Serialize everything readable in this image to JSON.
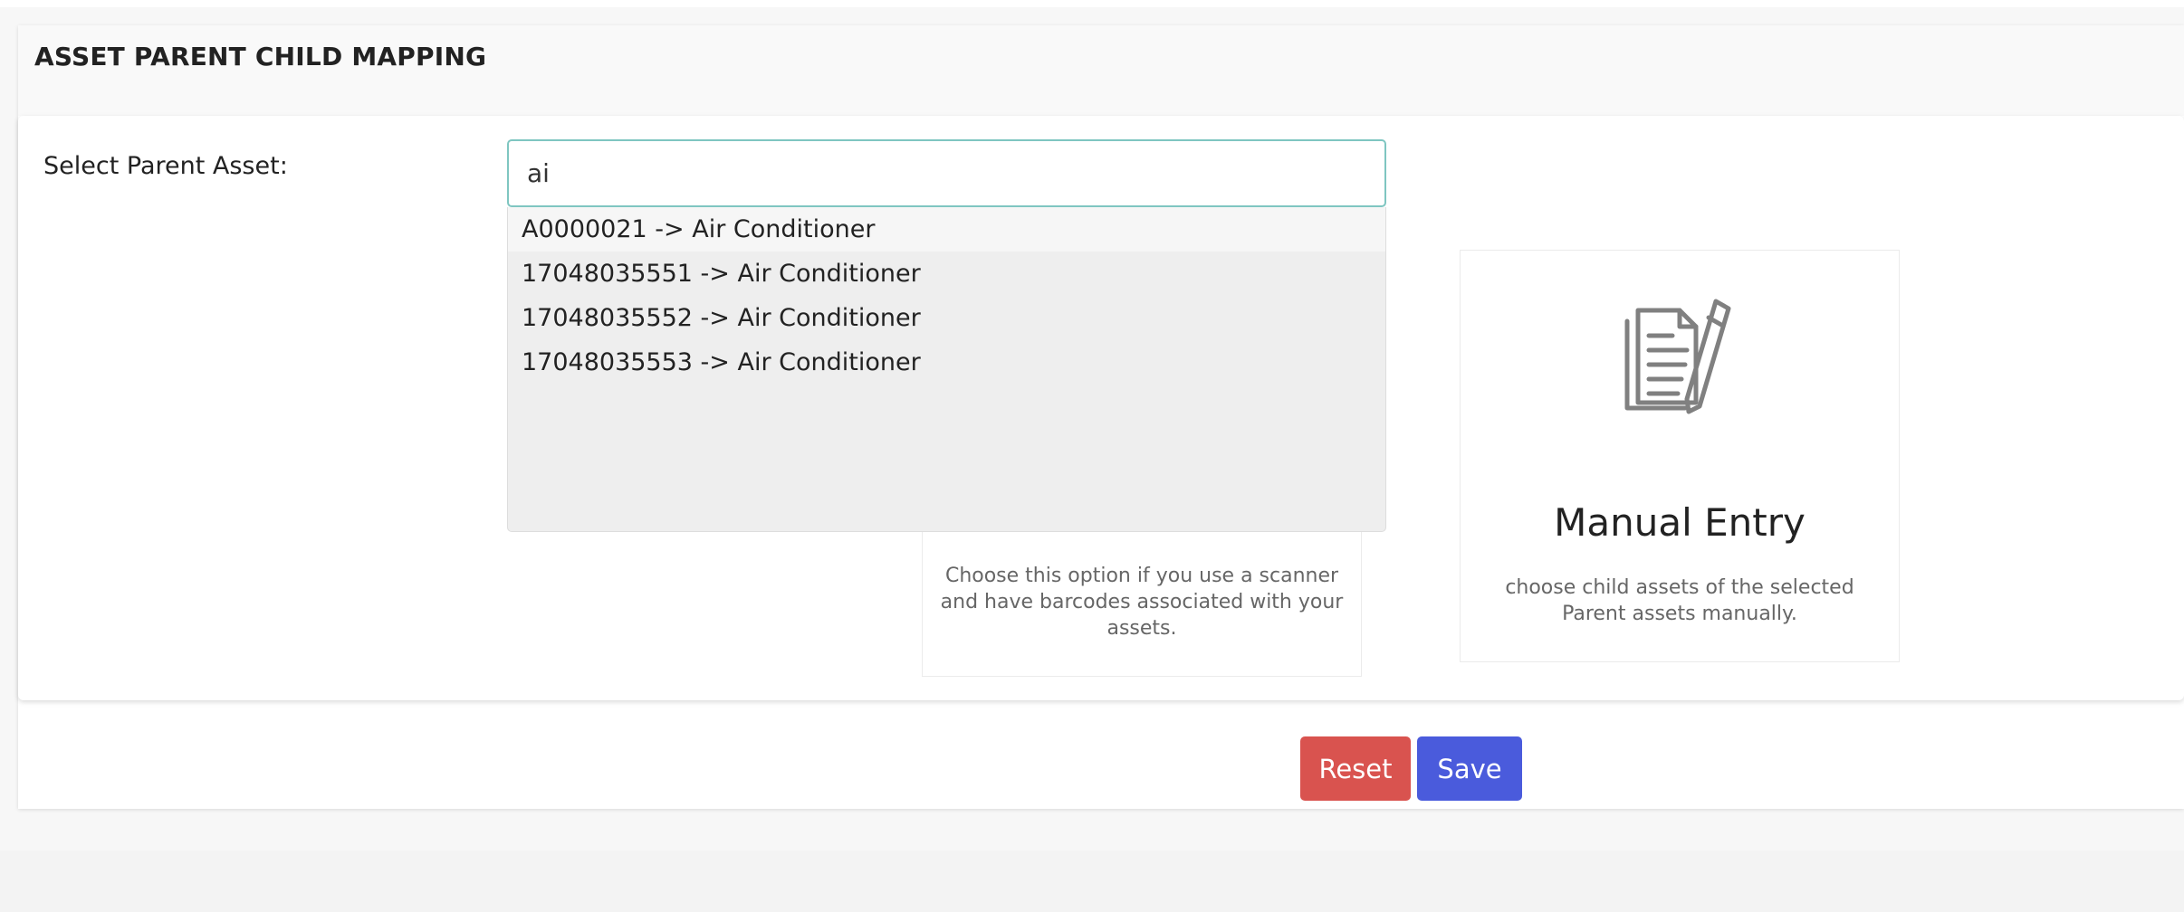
{
  "page": {
    "title": "ASSET PARENT CHILD MAPPING"
  },
  "form": {
    "parent_label": "Select Parent Asset:",
    "search_value": "ai"
  },
  "dropdown": {
    "items": [
      "A0000021 -> Air Conditioner",
      "17048035551 -> Air Conditioner",
      "17048035552 -> Air Conditioner",
      "17048035553 -> Air Conditioner"
    ]
  },
  "options": {
    "scanner": {
      "description": "Choose this option if you use a scanner and have barcodes associated with your assets."
    },
    "manual": {
      "title": "Manual Entry",
      "description": "choose child assets of the selected Parent assets manually.",
      "icon": "document-edit-icon"
    }
  },
  "actions": {
    "reset_label": "Reset",
    "save_label": "Save"
  },
  "colors": {
    "reset": "#d9534f",
    "save": "#4a5bdc",
    "input_focus": "#7fc6c1"
  }
}
